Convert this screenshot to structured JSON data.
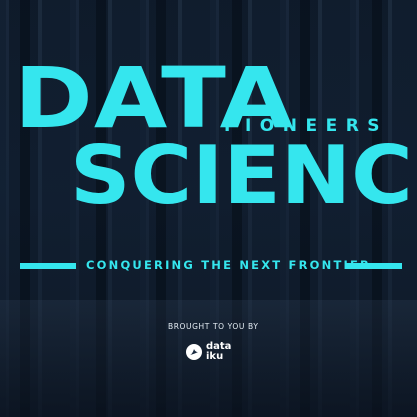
{
  "title": {
    "line1": "DATA",
    "tagline": "PIONEERS",
    "line2": "SCIENCE"
  },
  "subtitle": "CONQUERING THE NEXT FRONTIER",
  "sponsor": {
    "prefix": "BROUGHT TO YOU BY",
    "logo_line1": "data",
    "logo_line2": "iku",
    "logo_icon": "dataiku-bird-icon"
  },
  "colors": {
    "accent": "#35e6ee",
    "background": "#1a2a40",
    "sponsor_text": "#ffffff"
  }
}
